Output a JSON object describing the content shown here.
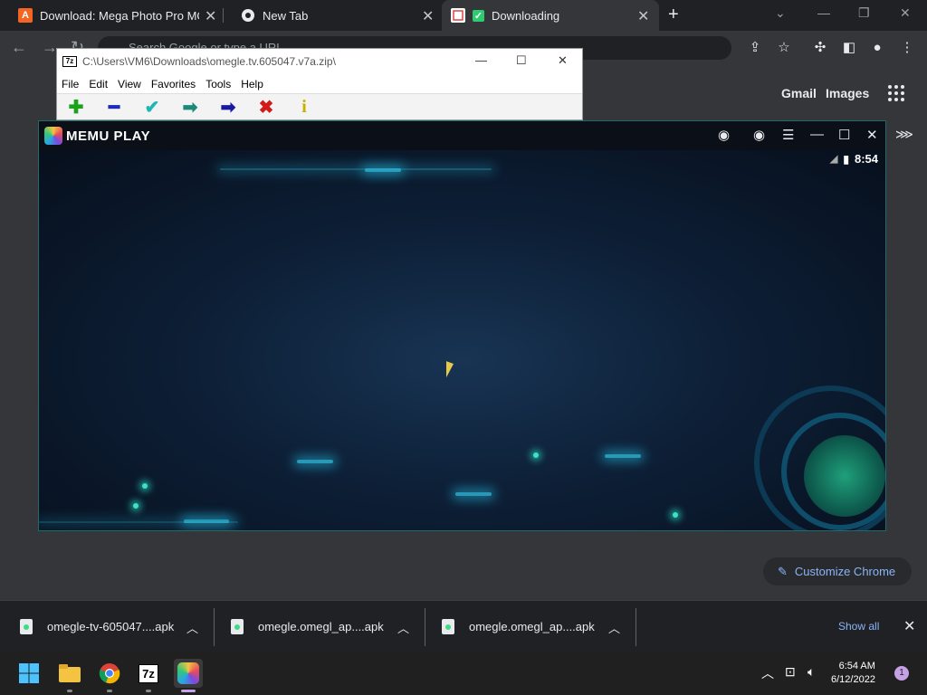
{
  "browser": {
    "tabs": [
      {
        "title": "Download: Mega Photo Pro MOD",
        "favicon": "A",
        "favicon_color": "#f26522"
      },
      {
        "title": "New Tab",
        "favicon": "chrome-icon"
      },
      {
        "title": "Downloading",
        "favicon": "check-icon",
        "favicon_color": "#2ecc71"
      }
    ],
    "new_tab_label": "+",
    "omnibox_placeholder": "Search Google or type a URL",
    "ntp_links": {
      "gmail": "Gmail",
      "images": "Images"
    },
    "customize_label": "Customize Chrome"
  },
  "zip_window": {
    "path": "C:\\Users\\VM6\\Downloads\\omegle.tv.605047.v7a.zip\\",
    "logo": "7z",
    "menu": [
      "File",
      "Edit",
      "View",
      "Favorites",
      "Tools",
      "Help"
    ],
    "tools": [
      {
        "name": "add",
        "glyph": "✚",
        "color": "#1aa31a"
      },
      {
        "name": "remove",
        "glyph": "━",
        "color": "#1d2bb8"
      },
      {
        "name": "test",
        "glyph": "✔",
        "color": "#1fb6b6"
      },
      {
        "name": "copy",
        "glyph": "➡",
        "color": "#1b8a7a"
      },
      {
        "name": "move",
        "glyph": "➡",
        "color": "#1a1aa0"
      },
      {
        "name": "delete",
        "glyph": "✖",
        "color": "#d11a1a"
      },
      {
        "name": "info",
        "glyph": "i",
        "color": "#c9b000"
      }
    ]
  },
  "memu": {
    "brand": "MEMU PLAY",
    "time": "8:54",
    "controls": [
      "account-icon",
      "settings-icon",
      "menu-icon",
      "minimize-icon",
      "maximize-icon",
      "close-icon",
      "expand-icon"
    ]
  },
  "downloads": {
    "items": [
      {
        "name": "omegle-tv-605047....apk"
      },
      {
        "name": "omegle.omegl_ap....apk"
      },
      {
        "name": "omegle.omegl_ap....apk"
      }
    ],
    "show_all": "Show all"
  },
  "taskbar": {
    "apps": [
      "windows-start-icon",
      "file-explorer-icon",
      "chrome-icon",
      "7zip-icon",
      "memu-icon"
    ],
    "zip_label": "7z",
    "time": "6:54 AM",
    "date": "6/12/2022",
    "notifications": "1"
  }
}
